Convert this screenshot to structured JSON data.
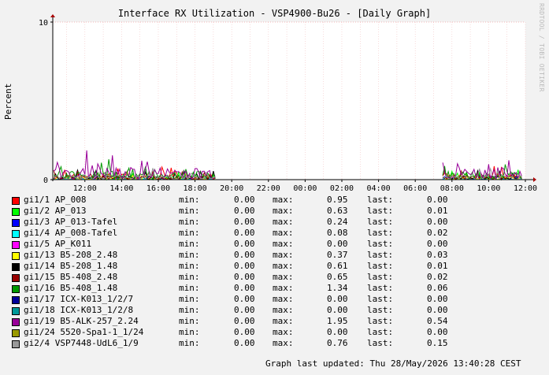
{
  "title": "Interface RX Utilization - VSP4900-Bu26 - [Daily Graph]",
  "credit": "RRDTOOL / TOBI OETIKER",
  "footer": "Graph last updated: Thu 28/May/2026 13:40:28 CEST",
  "chart_data": {
    "type": "area",
    "title": "Interface RX Utilization - VSP4900-Bu26 - [Daily Graph]",
    "ylabel": "Percent",
    "xlabel": "",
    "ylim": [
      0,
      10
    ],
    "yticks": [
      "0",
      "10"
    ],
    "x_range_hours": [
      10.25,
      36.0
    ],
    "xticks": [
      "12:00",
      "14:00",
      "16:00",
      "18:00",
      "20:00",
      "22:00",
      "00:00",
      "02:00",
      "04:00",
      "06:00",
      "08:00",
      "10:00",
      "12:00"
    ],
    "grid": true,
    "legend_position": "bottom",
    "series": [
      {
        "name": "gi1/1 AP_008",
        "color": "#ff0000",
        "min": "0.00",
        "max": "0.95",
        "last": "0.00"
      },
      {
        "name": "gi1/2 AP_013",
        "color": "#00ff00",
        "min": "0.00",
        "max": "0.63",
        "last": "0.01"
      },
      {
        "name": "gi1/3 AP_013-Tafel",
        "color": "#0000ff",
        "min": "0.00",
        "max": "0.24",
        "last": "0.00"
      },
      {
        "name": "gi1/4 AP_008-Tafel",
        "color": "#00ffff",
        "min": "0.00",
        "max": "0.08",
        "last": "0.02"
      },
      {
        "name": "gi1/5 AP_K011",
        "color": "#ff00ff",
        "min": "0.00",
        "max": "0.00",
        "last": "0.00"
      },
      {
        "name": "gi1/13 B5-208_2.48",
        "color": "#ffff00",
        "min": "0.00",
        "max": "0.37",
        "last": "0.03"
      },
      {
        "name": "gi1/14 B5-208_1.48",
        "color": "#000000",
        "min": "0.00",
        "max": "0.61",
        "last": "0.01"
      },
      {
        "name": "gi1/15 B5-408_2.48",
        "color": "#990000",
        "min": "0.00",
        "max": "0.65",
        "last": "0.02"
      },
      {
        "name": "gi1/16 B5-408_1.48",
        "color": "#009900",
        "min": "0.00",
        "max": "1.34",
        "last": "0.06"
      },
      {
        "name": "gi1/17 ICX-K013_1/2/7",
        "color": "#000099",
        "min": "0.00",
        "max": "0.00",
        "last": "0.00"
      },
      {
        "name": "gi1/18 ICX-K013_1/2/8",
        "color": "#009999",
        "min": "0.00",
        "max": "0.00",
        "last": "0.00"
      },
      {
        "name": "gi1/19 B5-ALK-257_2.24",
        "color": "#990099",
        "min": "0.00",
        "max": "1.95",
        "last": "0.54"
      },
      {
        "name": "gi1/24 5520-Spa1-1_1/24",
        "color": "#999900",
        "min": "0.00",
        "max": "0.00",
        "last": "0.00"
      },
      {
        "name": "gi2/4 VSP7448-UdL6_1/9",
        "color": "#999999",
        "min": "0.00",
        "max": "0.76",
        "last": "0.15"
      }
    ]
  },
  "legend_labels": {
    "min": "min:",
    "max": "max:",
    "last": "last:"
  }
}
